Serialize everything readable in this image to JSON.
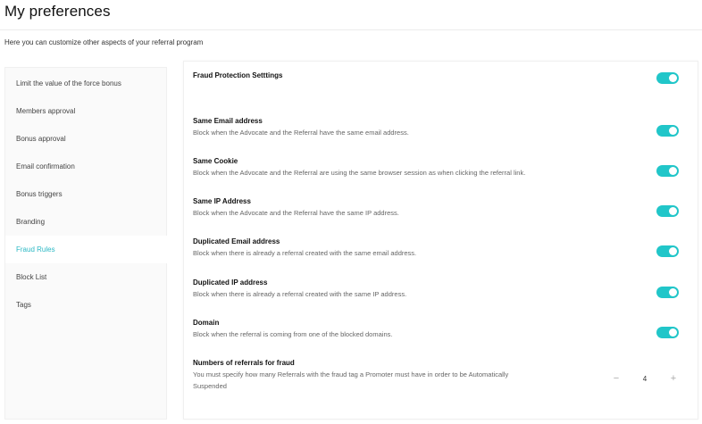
{
  "page": {
    "title": "My preferences",
    "subtitle": "Here you can customize other aspects of your referral program"
  },
  "sidebar": {
    "active_index": 6,
    "items": [
      {
        "label": "Limit the value of the force bonus"
      },
      {
        "label": "Members approval"
      },
      {
        "label": "Bonus approval"
      },
      {
        "label": "Email confirmation"
      },
      {
        "label": "Bonus triggers"
      },
      {
        "label": "Branding"
      },
      {
        "label": "Fraud Rules"
      },
      {
        "label": "Block List"
      },
      {
        "label": "Tags"
      }
    ]
  },
  "panel": {
    "header": {
      "title": "Fraud Protection Setttings",
      "toggle_on": true
    },
    "settings": [
      {
        "title": "Same Email address",
        "description": "Block when the Advocate and the Referral have the same email address.",
        "toggle_on": true
      },
      {
        "title": "Same Cookie",
        "description": "Block when the Advocate and the Referral are using the same browser session as when clicking the referral link.",
        "toggle_on": true
      },
      {
        "title": "Same IP Address",
        "description": "Block when the Advocate and the Referral have the same IP address.",
        "toggle_on": true
      },
      {
        "title": "Duplicated Email address",
        "description": "Block when there is already a referral created with the same email address.",
        "toggle_on": true
      },
      {
        "title": "Duplicated IP address",
        "description": "Block when there is already a referral created with the same IP address.",
        "toggle_on": true
      },
      {
        "title": "Domain",
        "description": "Block when the referral is coming from one of the blocked domains.",
        "toggle_on": true
      }
    ],
    "fraud_count": {
      "title": "Numbers of referrals for fraud",
      "description_line1": "You must specify how many Referrals with the fraud tag a Promoter must have in order to be Automatically",
      "description_line2": "Suspended",
      "value": "4",
      "minus": "−",
      "plus": "+"
    }
  },
  "colors": {
    "accent": "#21c6c9",
    "active_link": "#2bb8c4"
  }
}
